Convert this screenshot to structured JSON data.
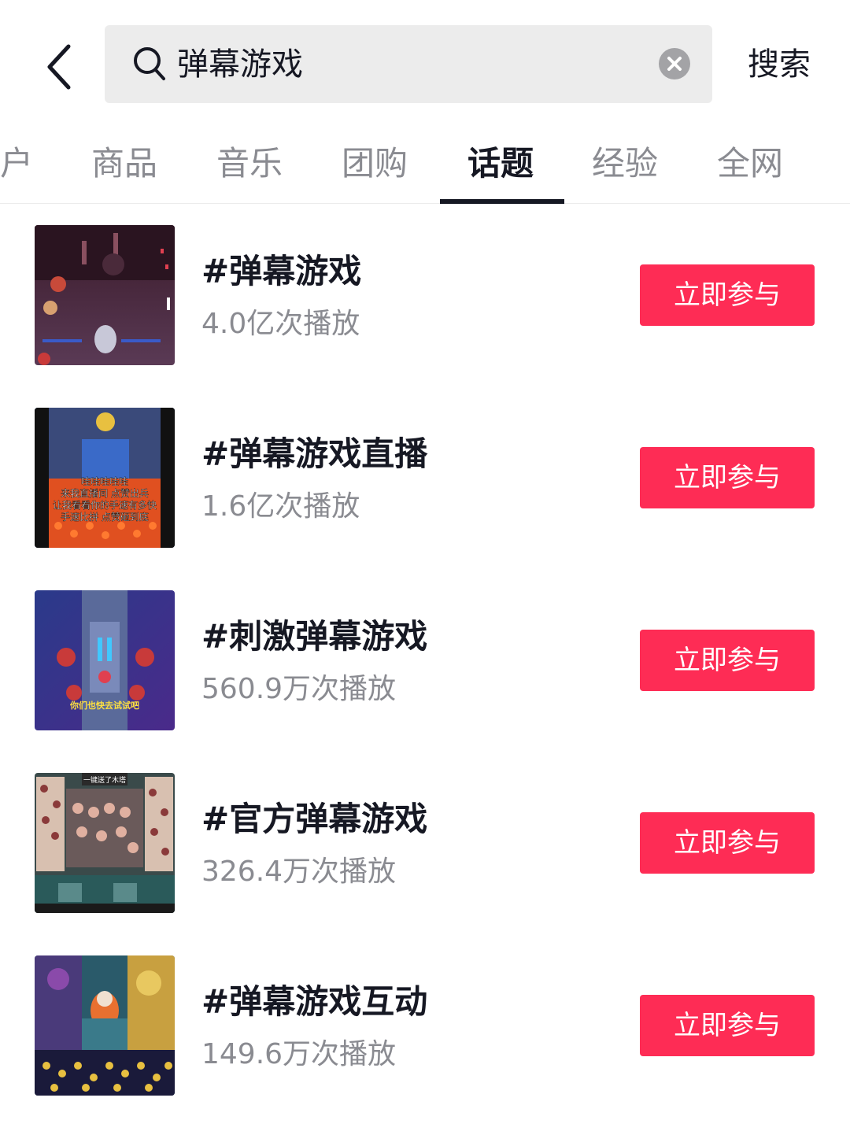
{
  "search": {
    "query": "弹幕游戏",
    "submit_label": "搜索"
  },
  "icons": {
    "back": "chevron-left-icon",
    "search": "search-icon",
    "clear": "clear-circle-icon"
  },
  "colors": {
    "accent": "#fe2c55",
    "primary_text": "#161823",
    "secondary_text": "#8a8b91",
    "search_bg": "#ececec"
  },
  "tabs": {
    "items": [
      {
        "label": "户"
      },
      {
        "label": "商品"
      },
      {
        "label": "音乐"
      },
      {
        "label": "团购"
      },
      {
        "label": "话题",
        "active": true
      },
      {
        "label": "经验"
      },
      {
        "label": "全网"
      }
    ]
  },
  "topics": [
    {
      "title": "#弹幕游戏",
      "plays": "4.0亿次播放",
      "action": "立即参与"
    },
    {
      "title": "#弹幕游戏直播",
      "plays": "1.6亿次播放",
      "action": "立即参与",
      "thumb_caption": [
        "哇哇哇哇哇",
        "来我直播间 点赞出兵",
        "让我看看你的手速有多快",
        "手速比拼 点赞砸到底"
      ]
    },
    {
      "title": "#刺激弹幕游戏",
      "plays": "560.9万次播放",
      "action": "立即参与",
      "thumb_caption": [
        "你们也快去试试吧"
      ]
    },
    {
      "title": "#官方弹幕游戏",
      "plays": "326.4万次播放",
      "action": "立即参与",
      "thumb_caption": [
        "一键送了木塔"
      ]
    },
    {
      "title": "#弹幕游戏互动",
      "plays": "149.6万次播放",
      "action": "立即参与"
    }
  ]
}
